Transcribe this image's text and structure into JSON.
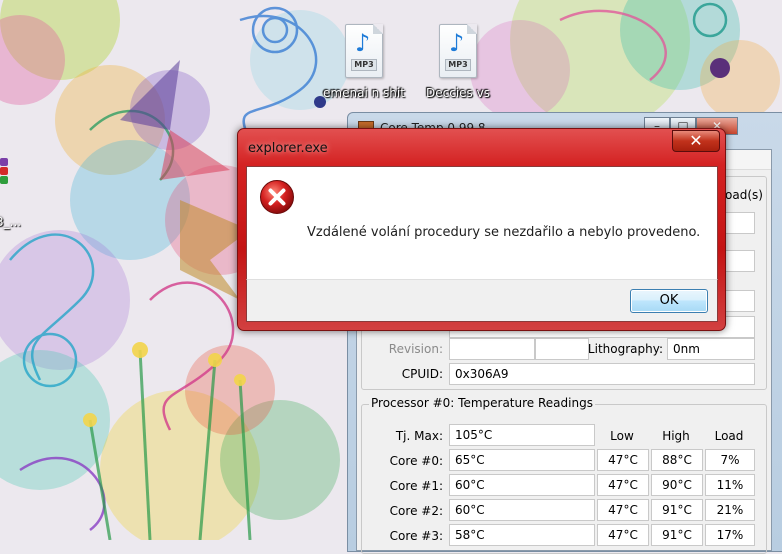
{
  "desktop": {
    "icons": [
      {
        "caption": "emenai n shit",
        "type": "MP3"
      },
      {
        "caption": "Deccies vs",
        "type": "MP3"
      }
    ],
    "partial_label": "3_..."
  },
  "coretemp": {
    "title": "Core Temp 0.99.8",
    "load_header": "oad(s)",
    "revision_label": "Revision:",
    "revision_value": "",
    "lithography_label": "Lithography:",
    "lithography_value": "0nm",
    "cpuid_label": "CPUID:",
    "cpuid_value": "0x306A9",
    "readings_title": "Processor #0: Temperature Readings",
    "tjmax_label": "Tj. Max:",
    "tjmax_value": "105°C",
    "columns": {
      "low": "Low",
      "high": "High",
      "load": "Load"
    },
    "cores": [
      {
        "label": "Core #0:",
        "temp": "65°C",
        "low": "47°C",
        "high": "88°C",
        "load": "7%"
      },
      {
        "label": "Core #1:",
        "temp": "60°C",
        "low": "47°C",
        "high": "90°C",
        "load": "11%"
      },
      {
        "label": "Core #2:",
        "temp": "60°C",
        "low": "47°C",
        "high": "91°C",
        "load": "21%"
      },
      {
        "label": "Core #3:",
        "temp": "58°C",
        "low": "47°C",
        "high": "91°C",
        "load": "17%"
      }
    ],
    "caption_buttons": {
      "minimize": "–",
      "maximize": "□",
      "close": "✕"
    }
  },
  "dialog": {
    "title": "explorer.exe",
    "message": "Vzdálené volání procedury se nezdařilo a nebylo provedeno.",
    "ok_label": "OK",
    "close_glyph": "✕",
    "icon": "error-icon"
  },
  "colors": {
    "dialog_frame": "#c41414",
    "ok_button": "#bee6fd",
    "error_icon": "#d42020"
  }
}
